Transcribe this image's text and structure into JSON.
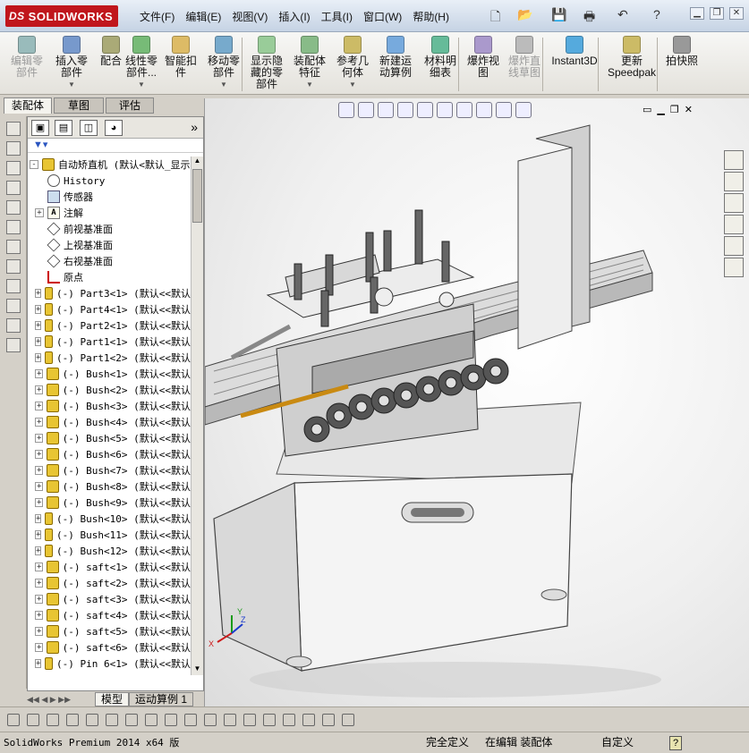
{
  "app": {
    "brand": "SOLIDWORKS",
    "brand_prefix": "DS"
  },
  "menu": [
    "文件(F)",
    "编辑(E)",
    "视图(V)",
    "插入(I)",
    "工具(I)",
    "窗口(W)",
    "帮助(H)"
  ],
  "ribbon": [
    {
      "label": "编辑零\n部件",
      "disabled": true
    },
    {
      "label": "插入零\n部件",
      "dropdown": true
    },
    {
      "label": "配合"
    },
    {
      "label": "线性零\n部件...",
      "dropdown": true
    },
    {
      "label": "智能扣\n件"
    },
    {
      "label": "移动零\n部件",
      "dropdown": true
    },
    {
      "label": "显示隐\n藏的零\n部件"
    },
    {
      "label": "装配体\n特征",
      "dropdown": true
    },
    {
      "label": "参考几\n何体",
      "dropdown": true
    },
    {
      "label": "新建运\n动算例"
    },
    {
      "label": "材料明\n细表"
    },
    {
      "label": "爆炸视\n图"
    },
    {
      "label": "爆炸直\n线草图",
      "disabled": true
    },
    {
      "label": "Instant3D"
    },
    {
      "label": "更新\nSpeedpak"
    },
    {
      "label": "拍快照"
    }
  ],
  "tabs": [
    "装配体",
    "草图",
    "评估"
  ],
  "tree": [
    {
      "label": "自动矫直机  (默认<默认_显示",
      "icon": "asm",
      "expand": "-",
      "indent": 0
    },
    {
      "label": "History",
      "icon": "hist",
      "indent": 1
    },
    {
      "label": "传感器",
      "icon": "sensor",
      "indent": 1
    },
    {
      "label": "注解",
      "icon": "note",
      "expand": "+",
      "indent": 1
    },
    {
      "label": "前视基准面",
      "icon": "plane",
      "indent": 1
    },
    {
      "label": "上视基准面",
      "icon": "plane",
      "indent": 1
    },
    {
      "label": "右视基准面",
      "icon": "plane",
      "indent": 1
    },
    {
      "label": "原点",
      "icon": "origin",
      "indent": 1
    },
    {
      "label": "(-) Part3<1> (默认<<默认",
      "icon": "part",
      "expand": "+",
      "indent": 1
    },
    {
      "label": "(-) Part4<1> (默认<<默认",
      "icon": "part",
      "expand": "+",
      "indent": 1
    },
    {
      "label": "(-) Part2<1> (默认<<默认",
      "icon": "part",
      "expand": "+",
      "indent": 1
    },
    {
      "label": "(-) Part1<1> (默认<<默认",
      "icon": "part",
      "expand": "+",
      "indent": 1
    },
    {
      "label": "(-) Part1<2> (默认<<默认",
      "icon": "part",
      "expand": "+",
      "indent": 1
    },
    {
      "label": "(-) Bush<1> (默认<<默认",
      "icon": "part",
      "expand": "+",
      "indent": 1
    },
    {
      "label": "(-) Bush<2> (默认<<默认",
      "icon": "part",
      "expand": "+",
      "indent": 1
    },
    {
      "label": "(-) Bush<3> (默认<<默认",
      "icon": "part",
      "expand": "+",
      "indent": 1
    },
    {
      "label": "(-) Bush<4> (默认<<默认",
      "icon": "part",
      "expand": "+",
      "indent": 1
    },
    {
      "label": "(-) Bush<5> (默认<<默认",
      "icon": "part",
      "expand": "+",
      "indent": 1
    },
    {
      "label": "(-) Bush<6> (默认<<默认",
      "icon": "part",
      "expand": "+",
      "indent": 1
    },
    {
      "label": "(-) Bush<7> (默认<<默认",
      "icon": "part",
      "expand": "+",
      "indent": 1
    },
    {
      "label": "(-) Bush<8> (默认<<默认",
      "icon": "part",
      "expand": "+",
      "indent": 1
    },
    {
      "label": "(-) Bush<9> (默认<<默认",
      "icon": "part",
      "expand": "+",
      "indent": 1
    },
    {
      "label": "(-) Bush<10> (默认<<默认",
      "icon": "part",
      "expand": "+",
      "indent": 1
    },
    {
      "label": "(-) Bush<11> (默认<<默认",
      "icon": "part",
      "expand": "+",
      "indent": 1
    },
    {
      "label": "(-) Bush<12> (默认<<默认",
      "icon": "part",
      "expand": "+",
      "indent": 1
    },
    {
      "label": "(-) saft<1> (默认<<默认",
      "icon": "part",
      "expand": "+",
      "indent": 1
    },
    {
      "label": "(-) saft<2> (默认<<默认",
      "icon": "part",
      "expand": "+",
      "indent": 1
    },
    {
      "label": "(-) saft<3> (默认<<默认",
      "icon": "part",
      "expand": "+",
      "indent": 1
    },
    {
      "label": "(-) saft<4> (默认<<默认",
      "icon": "part",
      "expand": "+",
      "indent": 1
    },
    {
      "label": "(-) saft<5> (默认<<默认",
      "icon": "part",
      "expand": "+",
      "indent": 1
    },
    {
      "label": "(-) saft<6> (默认<<默认",
      "icon": "part",
      "expand": "+",
      "indent": 1
    },
    {
      "label": "(-) Pin 6<1> (默认<<默认",
      "icon": "part",
      "expand": "+",
      "indent": 1
    }
  ],
  "bottom_tabs": [
    "模型",
    "运动算例 1"
  ],
  "status": {
    "product": "SolidWorks Premium 2014 x64 版",
    "constraint": "完全定义",
    "mode": "在编辑 装配体",
    "custom": "自定义"
  },
  "triad": {
    "x": "X",
    "y": "Y",
    "z": "Z"
  }
}
